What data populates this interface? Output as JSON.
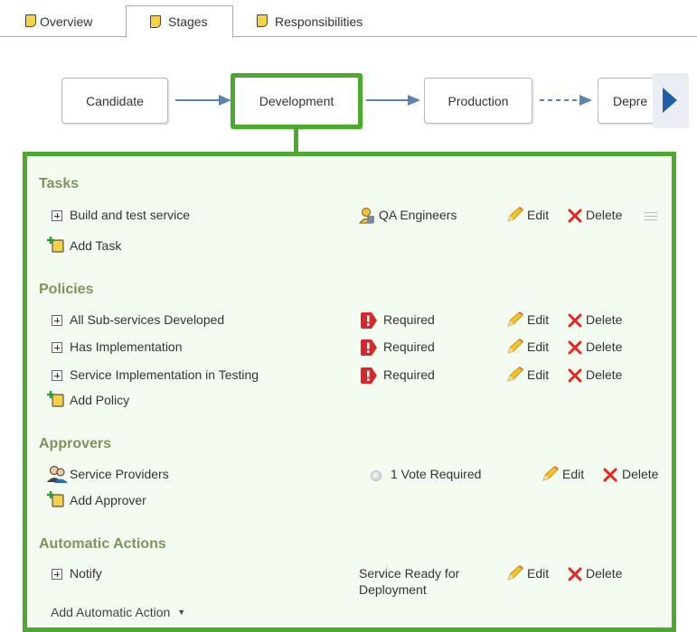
{
  "tabs": [
    {
      "label": "Overview",
      "active": false
    },
    {
      "label": "Stages",
      "active": true
    },
    {
      "label": "Responsibilities",
      "active": false
    }
  ],
  "stages": [
    {
      "label": "Candidate"
    },
    {
      "label": "Development",
      "selected": true
    },
    {
      "label": "Production"
    },
    {
      "label": "Depre"
    }
  ],
  "tasks": {
    "title": "Tasks",
    "items": [
      {
        "name": "Build and test service",
        "assignee": "QA Engineers",
        "edit": "Edit",
        "delete": "Delete"
      }
    ],
    "add": "Add Task"
  },
  "policies": {
    "title": "Policies",
    "items": [
      {
        "name": "All Sub-services Developed",
        "status": "Required",
        "edit": "Edit",
        "delete": "Delete"
      },
      {
        "name": "Has Implementation",
        "status": "Required",
        "edit": "Edit",
        "delete": "Delete"
      },
      {
        "name": "Service Implementation in Testing",
        "status": "Required",
        "edit": "Edit",
        "delete": "Delete"
      }
    ],
    "add": "Add Policy"
  },
  "approvers": {
    "title": "Approvers",
    "items": [
      {
        "name": "Service Providers",
        "votes": "1 Vote Required",
        "edit": "Edit",
        "delete": "Delete"
      }
    ],
    "add": "Add Approver"
  },
  "actions": {
    "title": "Automatic Actions",
    "items": [
      {
        "name": "Notify",
        "trigger_line1": "Service Ready for",
        "trigger_line2": "Deployment",
        "edit": "Edit",
        "delete": "Delete"
      }
    ],
    "add": "Add Automatic Action"
  },
  "colors": {
    "accent": "#4ea72e",
    "section_title": "#7c955a",
    "panel_bg": "#f4fbf1",
    "arrow": "#5a83b0",
    "delete_x": "#e8251f"
  }
}
